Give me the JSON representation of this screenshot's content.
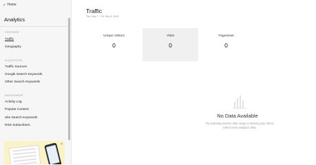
{
  "sidebar": {
    "back_label": "Home",
    "title": "Analytics",
    "sections": [
      {
        "label": "OVERVIEW",
        "items": [
          {
            "label": "Traffic",
            "active": true
          },
          {
            "label": "Geography"
          }
        ]
      },
      {
        "label": "ACQUISITION",
        "items": [
          {
            "label": "Traffic Sources"
          },
          {
            "label": "Google Search Keywords"
          },
          {
            "label": "Other Search Keywords"
          }
        ]
      },
      {
        "label": "ENGAGEMENT",
        "items": [
          {
            "label": "Activity Log"
          },
          {
            "label": "Popular Content"
          },
          {
            "label": "Site Search Keywords"
          },
          {
            "label": "RSS Subscribers"
          }
        ]
      }
    ],
    "promo_close": "×"
  },
  "main": {
    "title": "Traffic",
    "date_range": "Thu, Nov 7 – Fri, Dec 6, 2019",
    "stats": [
      {
        "label": "Unique Visitors",
        "value": "0"
      },
      {
        "label": "Visits",
        "value": "0",
        "highlighted": true
      },
      {
        "label": "Pageviews",
        "value": "0"
      }
    ],
    "empty_state": {
      "title": "No Data Available",
      "message": "Try selecting another date range or sharing your site to collect more analytics data."
    }
  }
}
